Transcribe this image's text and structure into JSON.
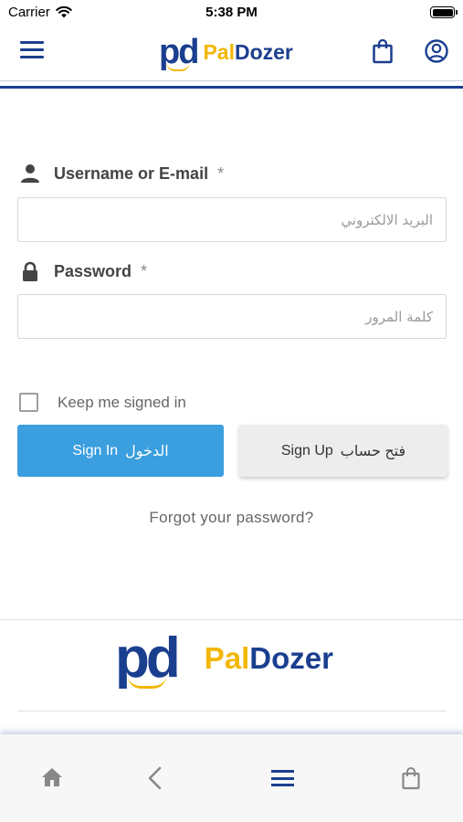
{
  "status_bar": {
    "carrier": "Carrier",
    "time": "5:38 PM"
  },
  "header": {
    "brand_mark": "pd",
    "brand_pal": "Pal",
    "brand_dozer": "Dozer"
  },
  "login_form": {
    "username": {
      "label": "Username or E-mail",
      "required_mark": "*",
      "placeholder": "البريد الالكتروني",
      "value": ""
    },
    "password": {
      "label": "Password",
      "required_mark": "*",
      "placeholder": "كلمة المرور",
      "value": ""
    },
    "keep_signed_in": {
      "label": "Keep me signed in",
      "checked": false
    },
    "sign_in_button": {
      "label_en": "Sign In",
      "label_ar": "الدخول"
    },
    "sign_up_button": {
      "label_en": "Sign Up",
      "label_ar": "فتح حساب"
    },
    "forgot_link": "Forgot your password?"
  },
  "footer": {
    "logo_mark": "pd",
    "logo_pal": "Pal",
    "logo_dozer": "Dozer"
  },
  "bottom_nav": {
    "icons": [
      "home-icon",
      "back-icon",
      "menu-icon",
      "bag-icon"
    ]
  },
  "colors": {
    "brand_blue": "#1b3f8f",
    "brand_yellow": "#f2b705",
    "sign_in_blue": "#3b9ede"
  }
}
